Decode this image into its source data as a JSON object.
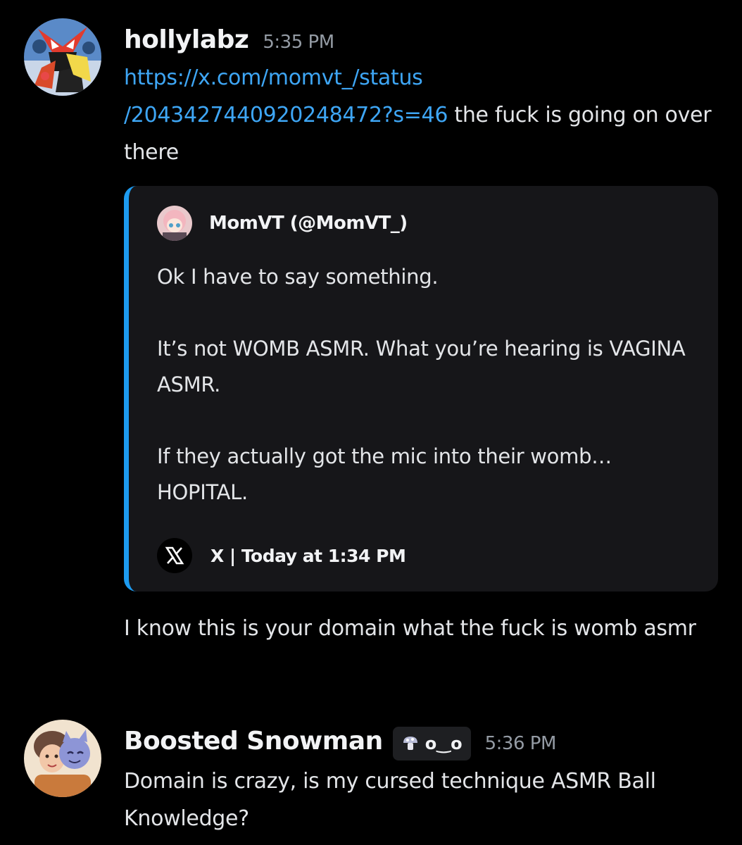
{
  "messages": [
    {
      "username": "hollylabz",
      "timestamp": "5:35 PM",
      "link_line1": "https://x.com/momvt_/status",
      "link_line2": "/2043427440920248472?s=46",
      "text_after_link": " the fuck is going on over there",
      "followup_text": "I know this is your domain what the fuck is womb asmr",
      "avatar_icon": "masked-character-avatar"
    },
    {
      "username": "Boosted Snowman",
      "badge_text": "o‿o",
      "badge_icon": "mushroom-icon",
      "timestamp": "5:36 PM",
      "text": "Domain is crazy, is my cursed technique ASMR Ball Knowledge?",
      "avatar_icon": "two-characters-avatar"
    }
  ],
  "embed": {
    "author": "MomVT (@MomVT_)",
    "paragraphs": [
      "Ok I have to say something.",
      "It’s not WOMB ASMR. What you’re hearing is VAGINA ASMR.",
      "If they actually got the mic into their womb… HOPITAL."
    ],
    "footer": "X | Today at 1:34 PM",
    "accent_color": "#1d9bf0"
  },
  "colors": {
    "background": "#000000",
    "link": "#3ea6f5",
    "timestamp": "#949ba4",
    "embed_bg": "#161619"
  }
}
